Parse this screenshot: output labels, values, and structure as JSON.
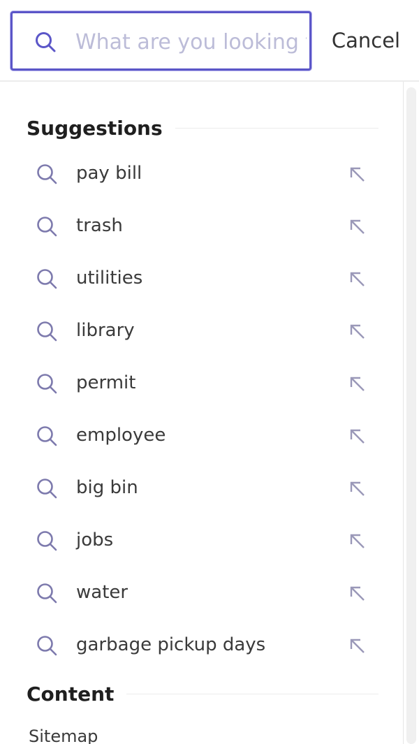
{
  "search": {
    "value": "",
    "placeholder": "What are you looking for?",
    "cancel_label": "Cancel"
  },
  "sections": {
    "suggestions_title": "Suggestions",
    "content_title": "Content"
  },
  "suggestions": [
    {
      "label": "pay bill"
    },
    {
      "label": "trash"
    },
    {
      "label": "utilities"
    },
    {
      "label": "library"
    },
    {
      "label": "permit"
    },
    {
      "label": "employee"
    },
    {
      "label": "big bin"
    },
    {
      "label": "jobs"
    },
    {
      "label": "water"
    },
    {
      "label": "garbage pickup days"
    }
  ],
  "content": {
    "items": [
      {
        "label": "Sitemap"
      }
    ]
  },
  "icons": {
    "search_input": "search-icon",
    "suggestion": "search-icon",
    "fill_query": "arrow-up-left-icon"
  },
  "colors": {
    "accent": "#5b56c8",
    "icon": "#7d7aad",
    "placeholder": "#bcbcd8"
  }
}
